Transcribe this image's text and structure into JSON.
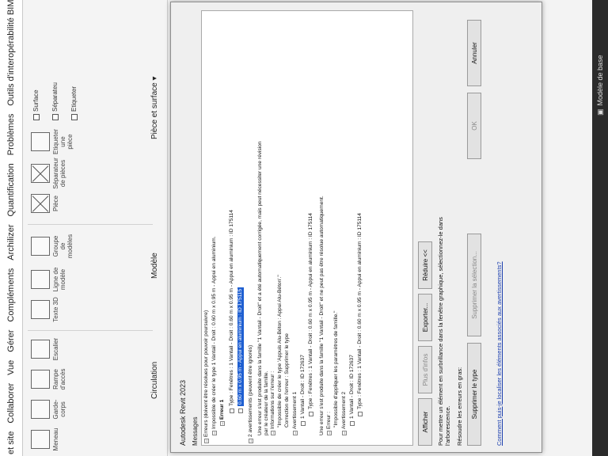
{
  "ribbon": {
    "tabs": [
      "et site",
      "Collaborer",
      "Vue",
      "Gérer",
      "Compléments",
      "Archilizer",
      "Quantification",
      "Problèmes",
      "Outils d'interopérabilité BIM"
    ],
    "panels": {
      "circulation": "Circulation",
      "modele": "Modèle",
      "piece_surface": "Pièce et surface"
    },
    "buttons": {
      "meneau": "Meneau",
      "garde_corps": "Garde-corps",
      "rampe": "Rampe d'accès",
      "escalier": "Escalier",
      "texte": "Texte 3D",
      "ligne": "Ligne de modèle",
      "groupe": "Groupe de modèles",
      "piece": "Pièce",
      "separateur": "Séparateur de pièces",
      "etiqueter_piece": "Etiqueter une pièce",
      "surface": "Surface",
      "separateur_short": "Séparateu",
      "etiqueter_short": "Etiqueter"
    }
  },
  "dialog": {
    "title": "Autodesk Revit 2023",
    "messages_label": "Messages",
    "tree": {
      "errors_header": "Erreurs (doivent être résolues pour pouvoir poursuivre)",
      "impossible_create": "Impossible de créer le type 1 Vantail - Droit : 0.60 m x 0.95 m - Appui en aluminium.",
      "erreur1": "Erreur 1",
      "row_type": "Type : Fenêtres : 1 Vantail - Droit : 0.60 m x 0.95 m - Appui en aluminium : ID 175114",
      "row_selected": "0.60 m x 0.95 m - Appui en aluminium : ID 175115",
      "warnings_header": "2 avertissements (peuvent être ignorés)",
      "warning_text_1": "Une erreur s'est produite dans la famille \"1 Vantail - Droit\" et a été automatiquement corrigée, mais peut nécessiter une révision",
      "warning_text_1b": "par le créateur de la famille.",
      "info_error": "Informations sur l'erreur :",
      "impossible_type": "\"Impossible de créer le type 'Appuis Alu-Béton : Appui Alu-Béton'.\"",
      "correction": "Correction de l'erreur : Supprimer le type",
      "avert1": "Avertissement 1",
      "avert1_id": "1 Vantail - Droit : ID 172637",
      "avert1_type": "Type : Fenêtres : 1 Vantail - Droit : 0.60 m x 0.95 m - Appui en aluminium : ID 175114",
      "warning_text_2": "Une erreur s'est produite dans la famille \"1 Vantail - Droit\" et ne peut pas être résolue automatiquement.",
      "erreur_label": "Erreur :",
      "impossible_param": "\"Impossible d'appliquer les paramètres de famille.\"",
      "avert2": "Avertissement 2",
      "avert2_id": "1 Vantail - Droit : ID 172637",
      "avert2_type": "Type : Fenêtres : 1 Vantail - Droit : 0.60 m x 0.95 m - Appui en aluminium : ID 175114"
    },
    "buttons": {
      "afficher": "Afficher",
      "plus_infos": "Plus d'infos",
      "exporter": "Exporter...",
      "reduire": "Réduire <<",
      "supprimer_type": "Supprimer le type",
      "supprimer_selection": "Supprimer la sélection...",
      "ok": "OK",
      "annuler": "Annuler"
    },
    "info_text_1": "Pour mettre un élément en surbrillance dans la fenêtre graphique, sélectionnez-le dans",
    "info_text_2": "l'arborescence.",
    "resolve_label": "Résoudre les erreurs en gras:",
    "link": "Comment puis-je localiser les éléments associés aux avertissements?"
  },
  "status": {
    "model": "Modèle de base"
  }
}
